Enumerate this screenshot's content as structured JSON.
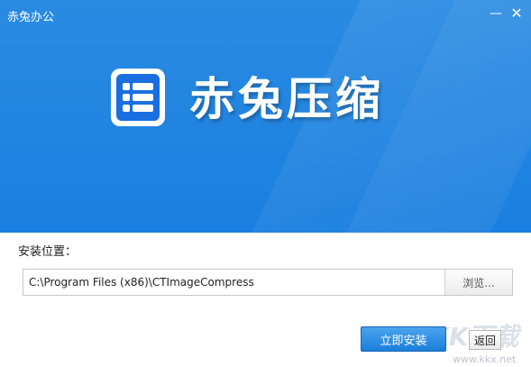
{
  "window": {
    "title": "赤兔办公",
    "minimize_symbol": "—",
    "close_symbol": "✕"
  },
  "banner": {
    "product_name": "赤兔压缩",
    "logo_icon": "list-app-icon"
  },
  "install": {
    "label": "安装位置：",
    "path_value": "C:\\Program Files (x86)\\CTImageCompress",
    "browse_label": "浏览...",
    "install_button": "立即安装",
    "back_button": "返回"
  },
  "watermark": {
    "text": "KK下载",
    "url": "www.kkx.net"
  },
  "colors": {
    "banner": "#1a7fe0",
    "accent": "#1c7fd9"
  }
}
